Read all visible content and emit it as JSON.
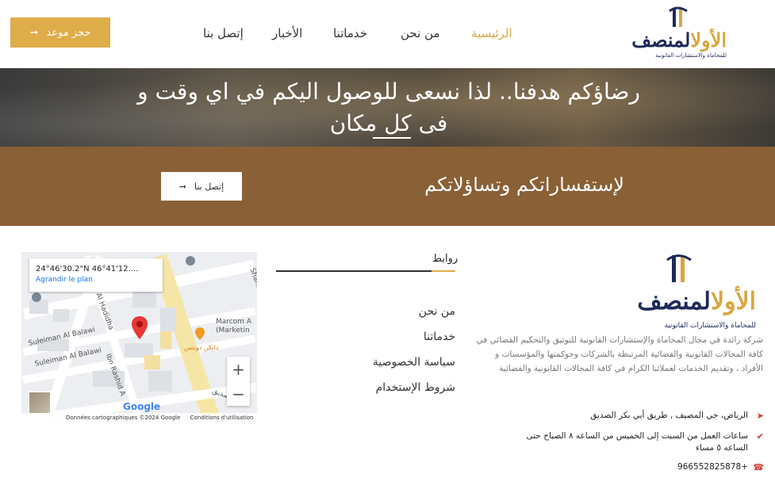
{
  "header": {
    "logo_main_dark": "المنصف",
    "logo_main_gold": "الأول",
    "logo_sub": "للمحاماة والاستشارات القانونية",
    "nav": [
      "الرئيسية",
      "من نحن",
      "خدماتنا",
      "الأخبار",
      "إتصل بنا"
    ],
    "book_button": "حجز موعد",
    "book_icon": "arrow-right-icon"
  },
  "hero": {
    "title_line1": "رضاؤكم هدفنا.. لذا نسعى للوصول اليكم في اي وقت و",
    "title_line2": "فى كل مكان"
  },
  "cta": {
    "text": "لإستفساراتكم وتساؤلاتكم",
    "button": "إتصل بنا"
  },
  "footer": {
    "logo_main_dark": "المنصف",
    "logo_main_gold": "الأول",
    "logo_sub": "للمحاماة والاستشارات القانونية",
    "about": "شركة رائدة في مجال المحاماة والإستشارات القانونية للتوثيق والتحكيم القضائي في كافة المجالات القانونية والقضائية المرتبطة بالشركات وحوكمتها والمؤسسات و الأفراد ، وتقديم الخدمات لعملائنا الكرام في كافة المجالات القانونية والقضائية",
    "address": "الرياض، حي المصيف , طريق أبي بكر الصديق",
    "hours": "ساعات العمل من السبت إلى الخميس من الساعه ٨ الصباح حتى الساعه ٥ مساء",
    "phone": "+966552825878",
    "links_title": "روابط",
    "links": [
      "من نحن",
      "خدماتنا",
      "سياسة الخصوصية",
      "شروط الإستخدام"
    ]
  },
  "map": {
    "coord": "24°46'30.2\"N 46°41'12....",
    "plan_link": "Agrandir le plan",
    "streets": [
      "Suleiman Al Balawi",
      "Suleiman Al Balawi",
      "Al Hadidha",
      "Ibn Rashid A",
      "Shahin",
      "Marcom A",
      "(Marketin"
    ],
    "poi": "دانكن دونتس",
    "poi2": "الصديق",
    "attribution": "Données cartographiques ©2024 Google",
    "terms": "Conditions d'utilisation",
    "google": "Google",
    "zoom_in": "+",
    "zoom_out": "−"
  }
}
